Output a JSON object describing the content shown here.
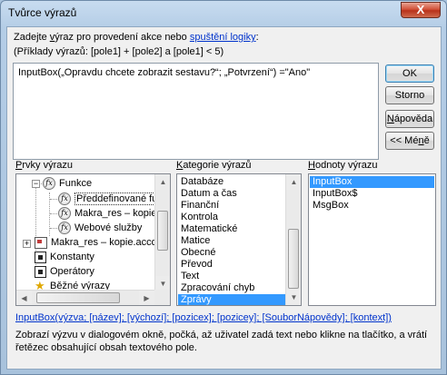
{
  "window": {
    "title": "Tvůrce výrazů",
    "close_glyph": "X"
  },
  "instructions": {
    "line1_prefix": "Zadejte ",
    "line1_u": "v",
    "line1_rest": "ýraz pro provedení akce nebo ",
    "line1_link": "spuštění logiky",
    "line1_suffix": ":",
    "line2": "(Příklady výrazů: [pole1] + [pole2] a [pole1] < 5)"
  },
  "expression": "InputBox(„Opravdu chcete zobrazit sestavu?“; „Potvrzení“) =\"Ano\"",
  "buttons": {
    "ok": "OK",
    "cancel": "Storno",
    "help_u": "N",
    "help_rest": "ápověda",
    "less_prefix": "<< Mé",
    "less_u": "n",
    "less_rest": "ě"
  },
  "labels": {
    "elements_u": "P",
    "elements_rest": "rvky výrazu",
    "categories_u": "K",
    "categories_rest": "ategorie výrazů",
    "values_u": "H",
    "values_rest": "odnoty výrazu"
  },
  "tree": {
    "functions": "Funkce",
    "builtin": "Předdefinované funkce",
    "makra1": "Makra_res – kopie",
    "web": "Webové služby",
    "makra2": "Makra_res – kopie.accdb",
    "constants": "Konstanty",
    "operators": "Operátory",
    "common": "Běžné výrazy"
  },
  "categories": [
    "Databáze",
    "Datum a čas",
    "Finanční",
    "Kontrola",
    "Matematické",
    "Matice",
    "Obecné",
    "Převod",
    "Text",
    "Zpracování chyb",
    "Zprávy"
  ],
  "selected_category": "Zprávy",
  "values": [
    "InputBox",
    "InputBox$",
    "MsgBox"
  ],
  "syntax_link": "InputBox(výzva; [název]; [výchozí]; [pozicex]; [pozicey]; [SouborNápovědy]; [kontext])",
  "description": "Zobrazí výzvu v dialogovém okně, počká, až uživatel zadá text nebo klikne na tlačítko, a vrátí řetězec obsahující obsah textového pole.",
  "colors": {
    "selection": "#3399ff",
    "link": "#0033cc",
    "accent_close": "#c9452b"
  }
}
